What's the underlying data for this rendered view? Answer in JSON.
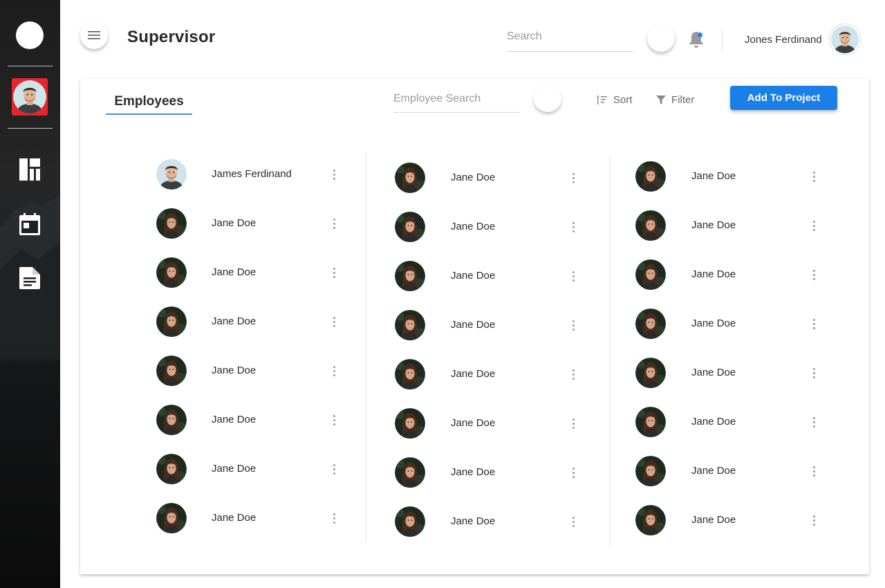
{
  "header": {
    "title": "Supervisor",
    "search_placeholder": "Search",
    "user_name": "Jones Ferdinand",
    "notification_dot_color": "#2e7dff"
  },
  "sidebar": {
    "items": [
      {
        "name": "dashboard",
        "icon": "dashboard-icon"
      },
      {
        "name": "calendar",
        "icon": "calendar-icon"
      },
      {
        "name": "documents",
        "icon": "document-icon"
      }
    ]
  },
  "card": {
    "tab_label": "Employees",
    "search_placeholder": "Employee Search",
    "sort_label": "Sort",
    "filter_label": "Filter",
    "add_button_label": "Add To Project",
    "accent_color": "#1a7fe6"
  },
  "employees": {
    "columns": [
      [
        {
          "name": "James Ferdinand",
          "avatar": "male"
        },
        {
          "name": "Jane Doe",
          "avatar": "female"
        },
        {
          "name": "Jane Doe",
          "avatar": "female"
        },
        {
          "name": "Jane Doe",
          "avatar": "female"
        },
        {
          "name": "Jane Doe",
          "avatar": "female"
        },
        {
          "name": "Jane Doe",
          "avatar": "female"
        },
        {
          "name": "Jane Doe",
          "avatar": "female"
        },
        {
          "name": "Jane Doe",
          "avatar": "female"
        }
      ],
      [
        {
          "name": "Jane Doe",
          "avatar": "female"
        },
        {
          "name": "Jane Doe",
          "avatar": "female"
        },
        {
          "name": "Jane Doe",
          "avatar": "female"
        },
        {
          "name": "Jane Doe",
          "avatar": "female"
        },
        {
          "name": "Jane Doe",
          "avatar": "female"
        },
        {
          "name": "Jane Doe",
          "avatar": "female"
        },
        {
          "name": "Jane Doe",
          "avatar": "female"
        },
        {
          "name": "Jane Doe",
          "avatar": "female"
        }
      ],
      [
        {
          "name": "Jane Doe",
          "avatar": "female"
        },
        {
          "name": "Jane Doe",
          "avatar": "female"
        },
        {
          "name": "Jane Doe",
          "avatar": "female"
        },
        {
          "name": "Jane Doe",
          "avatar": "female"
        },
        {
          "name": "Jane Doe",
          "avatar": "female"
        },
        {
          "name": "Jane Doe",
          "avatar": "female"
        },
        {
          "name": "Jane Doe",
          "avatar": "female"
        },
        {
          "name": "Jane Doe",
          "avatar": "female"
        }
      ]
    ]
  }
}
